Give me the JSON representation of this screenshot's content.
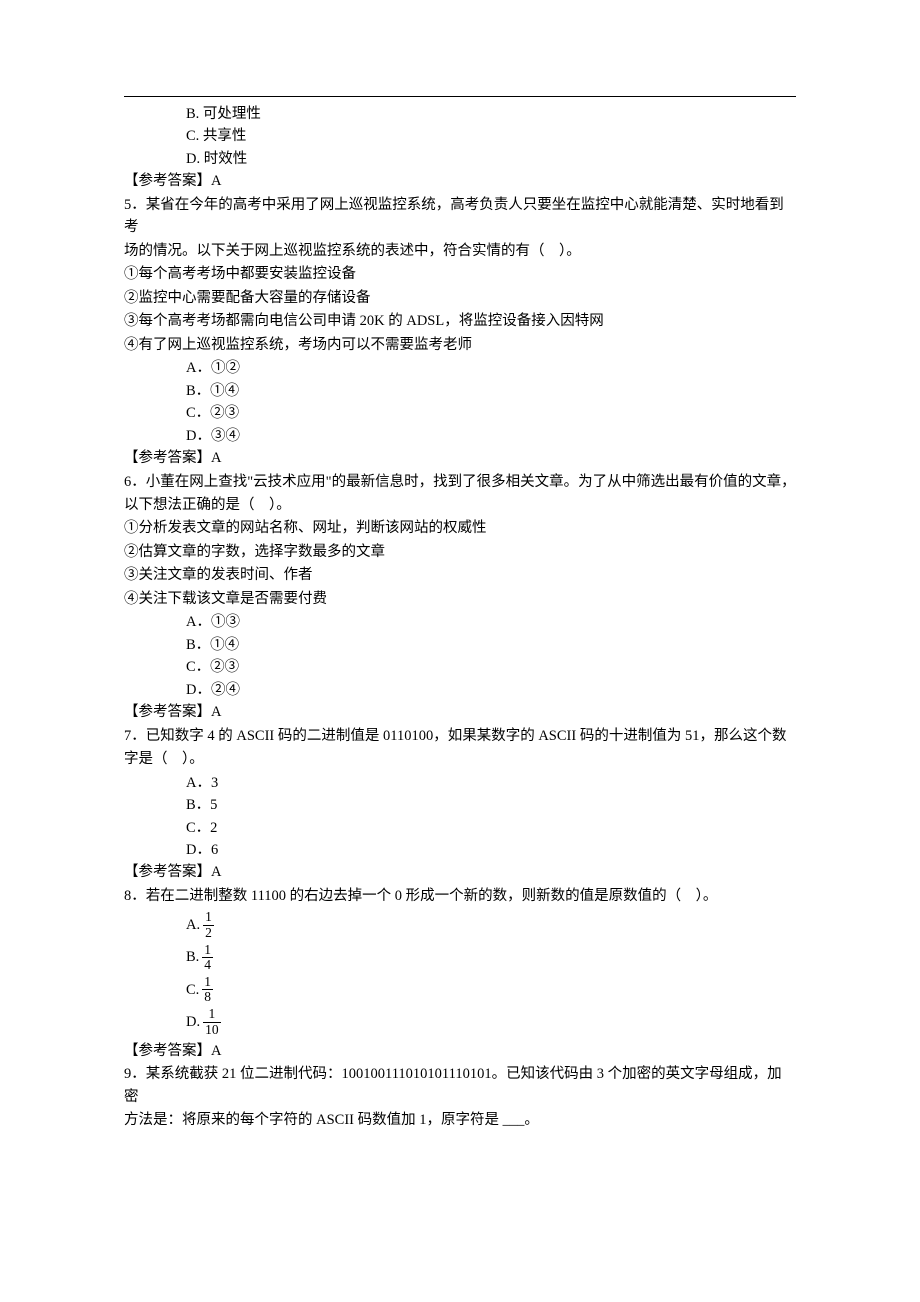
{
  "pre_options": {
    "b": {
      "letter": "B.",
      "text": "可处理性"
    },
    "c": {
      "letter": "C.",
      "text": "共享性"
    },
    "d": {
      "letter": "D.",
      "text": "时效性"
    }
  },
  "ans4": "【参考答案】A",
  "q5": {
    "stem1": "5．某省在今年的高考中采用了网上巡视监控系统，高考负责人只要坐在监控中心就能清楚、实时地看到考",
    "stem2": "场的情况。以下关于网上巡视监控系统的表述中，符合实情的有（　）。",
    "s1": "①每个高考考场中都要安装监控设备",
    "s2": "②监控中心需要配备大容量的存储设备",
    "s3": "③每个高考考场都需向电信公司申请 20K 的 ADSL，将监控设备接入因特网",
    "s4": "④有了网上巡视监控系统，考场内可以不需要监考老师",
    "a": {
      "l": "A．",
      "t": "①②"
    },
    "b": {
      "l": "B．",
      "t": "①④"
    },
    "c": {
      "l": "C．",
      "t": "②③"
    },
    "d": {
      "l": "D．",
      "t": "③④"
    }
  },
  "ans5": "【参考答案】A",
  "q6": {
    "stem1": "6．小董在网上查找\"云技术应用\"的最新信息时，找到了很多相关文章。为了从中筛选出最有价值的文章，",
    "stem2": "以下想法正确的是（　）。",
    "s1": "①分析发表文章的网站名称、网址，判断该网站的权威性",
    "s2": "②估算文章的字数，选择字数最多的文章",
    "s3": "③关注文章的发表时间、作者",
    "s4": "④关注下载该文章是否需要付费",
    "a": {
      "l": "A．",
      "t": "①③"
    },
    "b": {
      "l": "B．",
      "t": "①④"
    },
    "c": {
      "l": "C．",
      "t": "②③"
    },
    "d": {
      "l": "D．",
      "t": "②④"
    }
  },
  "ans6": "【参考答案】A",
  "q7": {
    "stem1": "7．已知数字 4 的 ASCII 码的二进制值是 0110100，如果某数字的 ASCII 码的十进制值为 51，那么这个数",
    "stem2": "字是（　）。",
    "a": {
      "l": "A．",
      "t": "3"
    },
    "b": {
      "l": "B．",
      "t": "5"
    },
    "c": {
      "l": "C．",
      "t": "2"
    },
    "d": {
      "l": "D．",
      "t": "6"
    }
  },
  "ans7": "【参考答案】A",
  "q8": {
    "stem": "8．若在二进制整数 11100 的右边去掉一个 0 形成一个新的数，则新数的值是原数值的（　）。",
    "a": {
      "l": "A.",
      "n": "1",
      "d": "2"
    },
    "b": {
      "l": "B.",
      "n": "1",
      "d": "4"
    },
    "c": {
      "l": "C.",
      "n": "1",
      "d": "8"
    },
    "d": {
      "l": "D.",
      "n": "1",
      "d": "10"
    }
  },
  "ans8": "【参考答案】A",
  "q9": {
    "stem1": "9．某系统截获 21 位二进制代码：100100111010101110101。已知该代码由 3 个加密的英文字母组成，加密",
    "stem2": "方法是：将原来的每个字符的 ASCII 码数值加 1，原字符是 ___。"
  }
}
